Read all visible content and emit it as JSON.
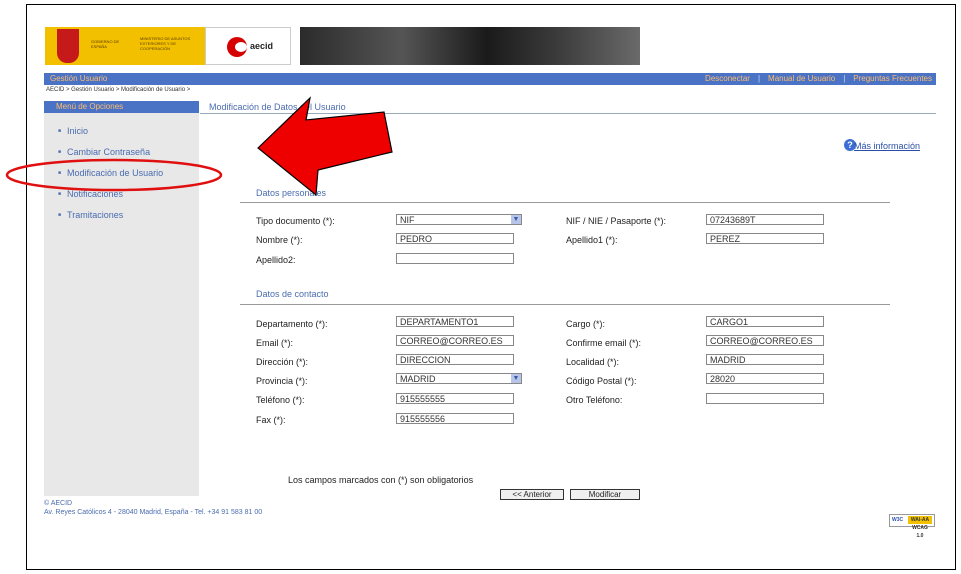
{
  "header": {
    "gov_line1": "GOBIERNO DE ESPAÑA",
    "gov_line2": "MINISTERIO DE ASUNTOS EXTERIORES Y DE COOPERACIÓN",
    "aecid_logo": "aecid"
  },
  "topbar": {
    "section": "Gestión Usuario",
    "links": [
      "Desconectar",
      "Manual de Usuario",
      "Preguntas Frecuentes"
    ]
  },
  "breadcrumb": "AECID > Gestión Usuario > Modificación de Usuario >",
  "sidebar": {
    "title": "Menú de Opciones",
    "items": [
      {
        "label": "Inicio"
      },
      {
        "label": "Cambiar Contraseña"
      },
      {
        "label": "Modificación de Usuario"
      },
      {
        "label": "Notificaciones"
      },
      {
        "label": "Tramitaciones"
      }
    ]
  },
  "content": {
    "title": "Modificación de Datos del Usuario",
    "more_info": "Más información",
    "more_info_icon": "question-icon",
    "personal_section": "Datos personales",
    "contact_section": "Datos de contacto",
    "fields": {
      "tipo_doc": {
        "label": "Tipo documento (*):",
        "value": "NIF"
      },
      "nif": {
        "label": "NIF / NIE / Pasaporte (*):",
        "value": "07243689T"
      },
      "nombre": {
        "label": "Nombre (*):",
        "value": "PEDRO"
      },
      "apellido1": {
        "label": "Apellido1 (*):",
        "value": "PEREZ"
      },
      "apellido2": {
        "label": "Apellido2:",
        "value": ""
      },
      "departamento": {
        "label": "Departamento (*):",
        "value": "DEPARTAMENTO1"
      },
      "cargo": {
        "label": "Cargo (*):",
        "value": "CARGO1"
      },
      "email": {
        "label": "Email (*):",
        "value": "CORREO@CORREO.ES"
      },
      "confirme_email": {
        "label": "Confirme email (*):",
        "value": "CORREO@CORREO.ES"
      },
      "direccion": {
        "label": "Dirección (*):",
        "value": "DIRECCION"
      },
      "localidad": {
        "label": "Localidad (*):",
        "value": "MADRID"
      },
      "provincia": {
        "label": "Provincia (*):",
        "value": "MADRID"
      },
      "codigo_postal": {
        "label": "Código Postal (*):",
        "value": "28020"
      },
      "telefono": {
        "label": "Teléfono (*):",
        "value": "915555555"
      },
      "otro_telefono": {
        "label": "Otro Teléfono:",
        "value": ""
      },
      "fax": {
        "label": "Fax (*):",
        "value": "915555556"
      }
    },
    "required_note": "Los campos marcados con (*) son obligatorios",
    "btn_prev": "<< Anterior",
    "btn_modify": "Modificar"
  },
  "footer": {
    "line1": "© AECID",
    "line2": "Av. Reyes Católicos 4 - 28040 Madrid, España - Tel. +34 91 583 81 00",
    "badge_left": "W3C",
    "badge_right": "WAI-AA WCAG 1.0"
  },
  "annotation_colors": {
    "arrow": "#ee0000",
    "ellipse": "#e01010"
  }
}
